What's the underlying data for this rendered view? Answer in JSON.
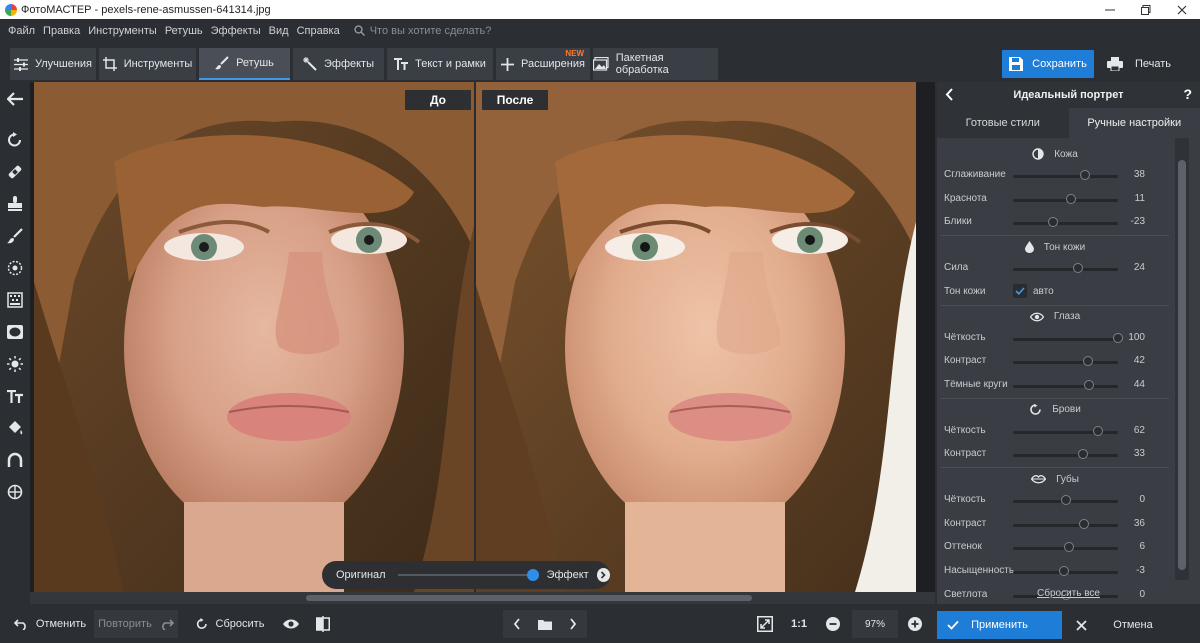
{
  "window": {
    "title": "ФотоМАСТЕР - pexels-rene-asmussen-641314.jpg"
  },
  "menu": {
    "items": [
      "Файл",
      "Правка",
      "Инструменты",
      "Ретушь",
      "Эффекты",
      "Вид",
      "Справка"
    ],
    "search_placeholder": "Что вы хотите сделать?"
  },
  "toolbar": {
    "tabs": [
      {
        "label": "Улучшения",
        "icon": "sliders-icon"
      },
      {
        "label": "Инструменты",
        "icon": "crop-icon"
      },
      {
        "label": "Ретушь",
        "icon": "brush-icon",
        "active": true
      },
      {
        "label": "Эффекты",
        "icon": "magic-wand-icon"
      },
      {
        "label": "Текст и рамки",
        "icon": "text-icon"
      },
      {
        "label": "Расширения",
        "icon": "plus-icon",
        "badge": "NEW"
      },
      {
        "label": "Пакетная обработка",
        "icon": "images-icon"
      }
    ],
    "save_label": "Сохранить",
    "print_label": "Печать"
  },
  "canvas": {
    "before_label": "До",
    "after_label": "После",
    "toggle": {
      "left": "Оригинал",
      "right": "Эффект"
    }
  },
  "panel": {
    "title": "Идеальный портрет",
    "help": "?",
    "tabs": [
      "Готовые стили",
      "Ручные настройки"
    ],
    "active_tab": 1,
    "sections": [
      {
        "title": "Кожа",
        "icon": "skin-icon",
        "rows": [
          {
            "label": "Сглаживание",
            "value": 38
          },
          {
            "label": "Краснота",
            "value": 11
          },
          {
            "label": "Блики",
            "value": -23
          }
        ]
      },
      {
        "title": "Тон кожи",
        "icon": "drop-icon",
        "rows": [
          {
            "label": "Сила",
            "value": 24
          },
          {
            "label": "Тон кожи",
            "checkbox": true,
            "checkbox_label": "авто"
          }
        ]
      },
      {
        "title": "Глаза",
        "icon": "eye-icon",
        "rows": [
          {
            "label": "Чёткость",
            "value": 100
          },
          {
            "label": "Контраст",
            "value": 42
          },
          {
            "label": "Тёмные круги",
            "value": 44
          }
        ]
      },
      {
        "title": "Брови",
        "icon": "brow-icon",
        "rows": [
          {
            "label": "Чёткость",
            "value": 62
          },
          {
            "label": "Контраст",
            "value": 33
          }
        ]
      },
      {
        "title": "Губы",
        "icon": "lips-icon",
        "rows": [
          {
            "label": "Чёткость",
            "value": 0
          },
          {
            "label": "Контраст",
            "value": 36
          },
          {
            "label": "Оттенок",
            "value": 6
          },
          {
            "label": "Насыщенность",
            "value": -3
          },
          {
            "label": "Светлота",
            "value": 0
          }
        ]
      }
    ],
    "reset_all": "Сбросить все"
  },
  "bottom": {
    "undo": "Отменить",
    "redo": "Повторить",
    "reset": "Сбросить",
    "zoom_ratio": "1:1",
    "zoom": "97%",
    "apply": "Применить",
    "cancel": "Отмена"
  },
  "colors": {
    "accent": "#1e7dd6",
    "new_badge": "#ff7a2d",
    "panel_bg": "#3a3e44",
    "app_bg": "#2b2e33"
  }
}
